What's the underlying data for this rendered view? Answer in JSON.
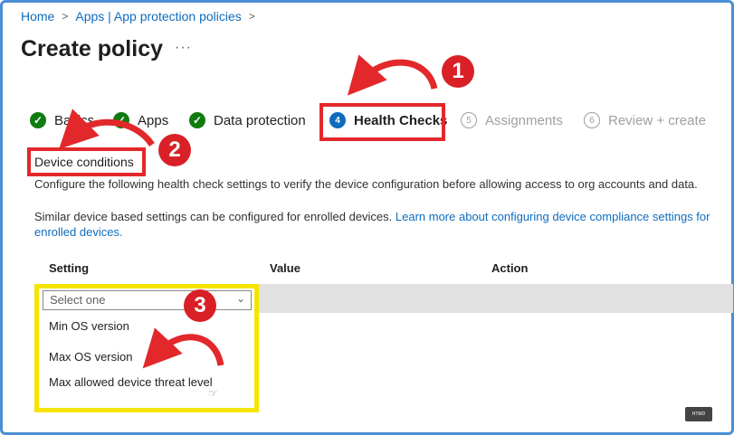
{
  "breadcrumb": {
    "home": "Home",
    "parent": "Apps | App protection policies"
  },
  "page": {
    "title": "Create policy",
    "more": "···"
  },
  "steps": [
    {
      "label": "Basics",
      "status": "done",
      "marker": "✓"
    },
    {
      "label": "Apps",
      "status": "done",
      "marker": "✓"
    },
    {
      "label": "Data protection",
      "status": "done",
      "marker": "✓"
    },
    {
      "label": "Health Checks",
      "status": "active",
      "marker": "4"
    },
    {
      "label": "Assignments",
      "status": "todo",
      "marker": "5"
    },
    {
      "label": "Review + create",
      "status": "todo",
      "marker": "6"
    }
  ],
  "section": {
    "title": "Device conditions",
    "description": "Configure the following health check settings to verify the device configuration before allowing access to org accounts and data.",
    "similar_text": "Similar device based settings can be configured for enrolled devices. ",
    "link_text": "Learn more about configuring device compliance settings for enrolled devices."
  },
  "table": {
    "headers": [
      "Setting",
      "Value",
      "Action"
    ]
  },
  "dropdown": {
    "selected": "Select one",
    "options": [
      "Min OS version",
      "Max OS version",
      "Max allowed device threat level"
    ]
  },
  "annotations": [
    "1",
    "2",
    "3"
  ],
  "watermark": "HTMD",
  "colors": {
    "accent": "#0f6cbd",
    "done": "#107c10",
    "annotation_red": "#e2282b",
    "highlight_yellow": "#f5e400"
  }
}
